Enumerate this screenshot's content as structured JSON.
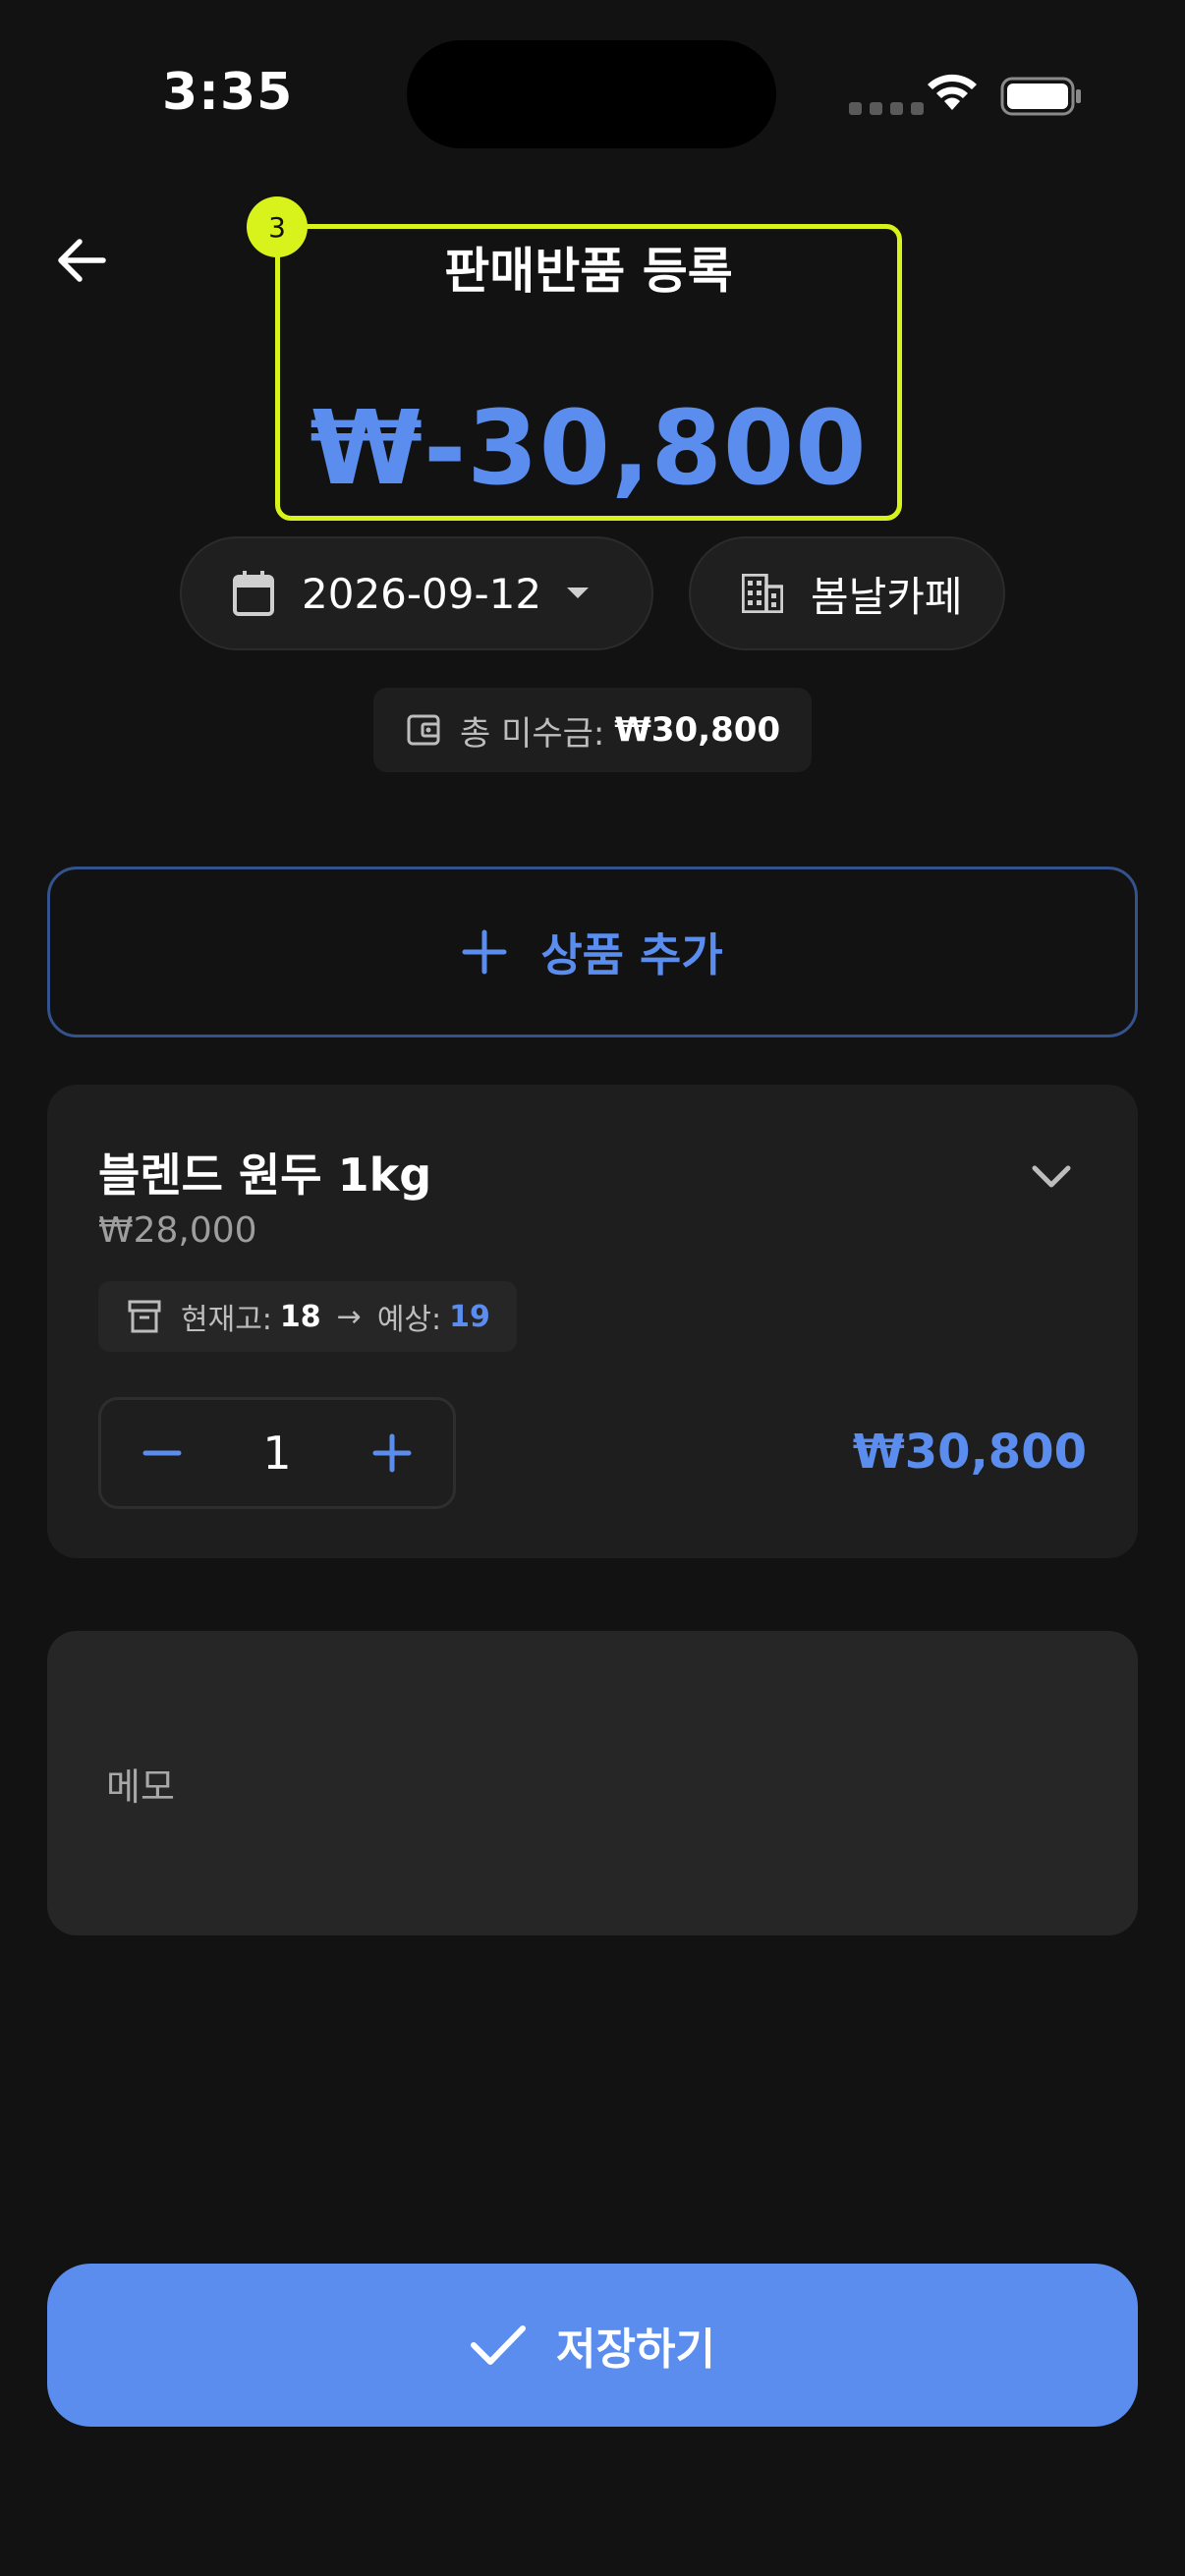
{
  "status_bar": {
    "time": "3:35"
  },
  "header": {
    "title": "판매반품 등록",
    "total_amount": "₩-30,800",
    "highlight_badge": "3"
  },
  "filters": {
    "date": "2026-09-12",
    "vendor": "봄날카페"
  },
  "unpaid": {
    "label": "총 미수금:",
    "value": "₩30,800"
  },
  "add_product": {
    "label": "상품 추가"
  },
  "product": {
    "name": "블렌드 원두 1kg",
    "price": "₩28,000",
    "stock_label": "현재고:",
    "stock_value": "18",
    "arrow": "→",
    "expected_label": "예상:",
    "expected_value": "19",
    "quantity": "1",
    "line_total": "₩30,800"
  },
  "memo": {
    "placeholder": "메모"
  },
  "save": {
    "label": "저장하기"
  },
  "colors": {
    "accent": "#5b8def",
    "highlight": "#d8f21c",
    "background": "#121212",
    "card": "#1e1e1e"
  },
  "icons": [
    "back-arrow-icon",
    "calendar-icon",
    "caret-down-icon",
    "building-icon",
    "wallet-icon",
    "plus-icon",
    "chevron-down-icon",
    "archive-icon",
    "minus-icon",
    "check-icon",
    "wifi-icon",
    "battery-icon"
  ]
}
